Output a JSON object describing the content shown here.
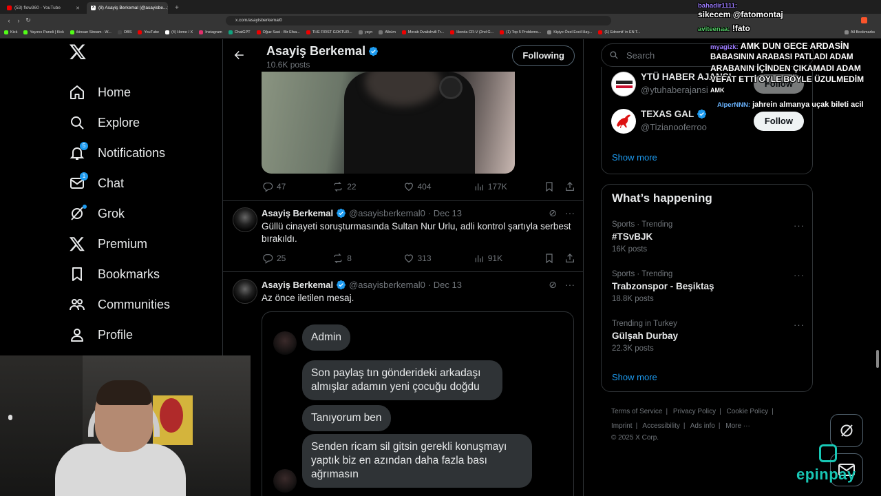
{
  "browser": {
    "tabs": [
      {
        "label": "(53) flow360 - YouTube"
      },
      {
        "label": "(8) Asayiş Berkemal (@asayisbe..."
      }
    ],
    "url": "x.com/asayisberkemal0",
    "bookmarks": [
      "Kick",
      "Yayıncı Paneli | Kick",
      "ikinsan Stream - W...",
      "OBS",
      "YouTube",
      "(4) Home / X",
      "Instagram",
      "ChatGPT",
      "Oğuz Sasi - Bir Efsa...",
      "THE FIRST GOKTUR...",
      "yayn",
      "Albüm",
      "Merab Dvalishvili Tr...",
      "Honda CR-V (2nd G...",
      "(1) Top 5 Problems...",
      "Kişiye Özel Excil Hay...",
      "(1) Edremit' in EN T...",
      "All Bookmarks"
    ]
  },
  "nav": {
    "items": [
      {
        "label": "Home",
        "icon": "home-icon"
      },
      {
        "label": "Explore",
        "icon": "search-icon"
      },
      {
        "label": "Notifications",
        "icon": "bell-icon",
        "badge": "5"
      },
      {
        "label": "Chat",
        "icon": "mail-icon",
        "badge": "1"
      },
      {
        "label": "Grok",
        "icon": "grok-icon"
      },
      {
        "label": "Premium",
        "icon": "x-logo-icon"
      },
      {
        "label": "Bookmarks",
        "icon": "bookmark-icon"
      },
      {
        "label": "Communities",
        "icon": "people-icon"
      },
      {
        "label": "Profile",
        "icon": "person-icon"
      }
    ]
  },
  "profile": {
    "name": "Asayiş Berkemal",
    "posts": "10.6K posts",
    "follow_label": "Following"
  },
  "tweets": [
    {
      "replies": "47",
      "reposts": "22",
      "likes": "404",
      "views": "177K"
    },
    {
      "name": "Asayiş Berkemal",
      "handle": "@asayisberkemal0",
      "date": "· Dec 13",
      "text": "Güllü cinayeti soruşturmasında Sultan Nur Urlu, adli kontrol şartıyla serbest bırakıldı.",
      "replies": "25",
      "reposts": "8",
      "likes": "313",
      "views": "91K"
    },
    {
      "name": "Asayiş Berkemal",
      "handle": "@asayisberkemal0",
      "date": "· Dec 13",
      "text": "Az önce iletilen mesaj."
    }
  ],
  "dm": {
    "bubbles": [
      "Admin",
      "Son paylaş tın gönderideki arkadaşı almışlar adamın yeni çocuğu doğdu",
      "Tanıyorum ben",
      "Senden ricam sil gitsin gerekli konuşmayı yaptık biz en azından daha fazla bası ağrımasın"
    ]
  },
  "search": {
    "placeholder": "Search"
  },
  "who_to_follow": [
    {
      "name": "YTÜ HABER AJANSI",
      "handle": "@ytuhaberajansi",
      "btn": "Follow"
    },
    {
      "name": "TEXAS GAL",
      "handle": "@Tizianooferroo",
      "btn": "Follow"
    }
  ],
  "show_more": "Show more",
  "happening": {
    "title": "What’s happening",
    "trends": [
      {
        "meta": "Sports · Trending",
        "name": "#TSvBJK",
        "count": "16K posts"
      },
      {
        "meta": "Sports · Trending",
        "name": "Trabzonspor - Beşiktaş",
        "count": "18.8K posts"
      },
      {
        "meta": "Trending in Turkey",
        "name": "Gülşah Durbay",
        "count": "22.3K posts"
      }
    ],
    "show_more": "Show more"
  },
  "footer": {
    "links": [
      "Terms of Service",
      "Privacy Policy",
      "Cookie Policy",
      "Imprint",
      "Accessibility",
      "Ads info",
      "More ···"
    ],
    "copyright": "© 2025 X Corp."
  },
  "chat_overlay": {
    "lines": [
      {
        "user": "bahadir1111:",
        "text": ""
      },
      {
        "user": "",
        "text": "sikecem @fatomontaj"
      },
      {
        "user": "aviteenaa:",
        "text": "!fato"
      },
      {
        "user": "myagizk:",
        "text": "AMK DUN GECE ARDASİN"
      },
      {
        "user": "",
        "text": "BABASININ ARABASI PATLADI ADAM"
      },
      {
        "user": "",
        "text": "ARABANIN İÇİNDEN ÇIKAMADI ADAM"
      },
      {
        "user": "",
        "text": "VEFAT ETTİ ÖYLE BÖYLE ÜZULMEDİM"
      },
      {
        "user": "",
        "text": "AMK"
      },
      {
        "user": "AlperNNN:",
        "text": "jahrein almanya uçak bileti acil"
      }
    ]
  },
  "sponsor": "epinpay",
  "colors": {
    "accent": "#1d9bf0",
    "border": "#2f3336",
    "muted": "#71767b",
    "sponsor": "#18c7b5"
  }
}
